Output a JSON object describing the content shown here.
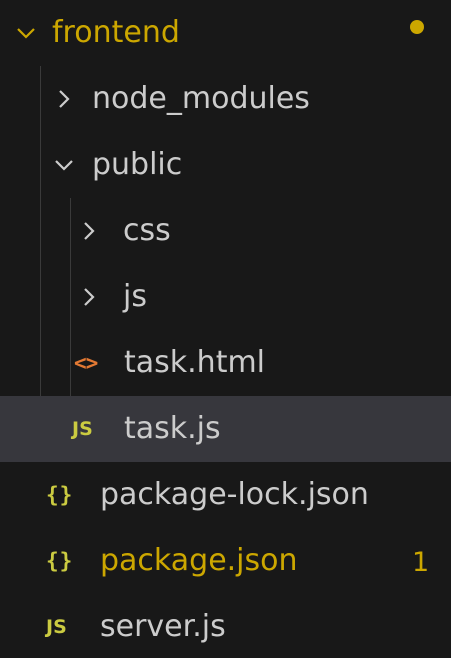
{
  "colors": {
    "background": "#181818",
    "selected_row": "#37373d",
    "modified_text": "#cca700",
    "default_text": "#cccccc",
    "json_icon": "#cbcb41",
    "js_icon": "#cbcb41",
    "html_icon": "#e37933"
  },
  "tree": {
    "root": {
      "label": "frontend",
      "expanded": true,
      "modified": true
    },
    "node_modules": {
      "label": "node_modules",
      "expanded": false
    },
    "public": {
      "label": "public",
      "expanded": true
    },
    "css": {
      "label": "css",
      "expanded": false
    },
    "js": {
      "label": "js",
      "expanded": false
    },
    "task_html": {
      "label": "task.html",
      "icon": "html-file-icon",
      "icon_text": "<>"
    },
    "task_js": {
      "label": "task.js",
      "icon": "js-file-icon",
      "icon_text": "JS",
      "selected": true
    },
    "package_lock": {
      "label": "package-lock.json",
      "icon": "json-file-icon",
      "icon_text": "{}"
    },
    "package_json": {
      "label": "package.json",
      "icon": "json-file-icon",
      "icon_text": "{}",
      "modified": true,
      "problem_count": "1"
    },
    "server_js": {
      "label": "server.js",
      "icon": "js-file-icon",
      "icon_text": "JS"
    }
  }
}
